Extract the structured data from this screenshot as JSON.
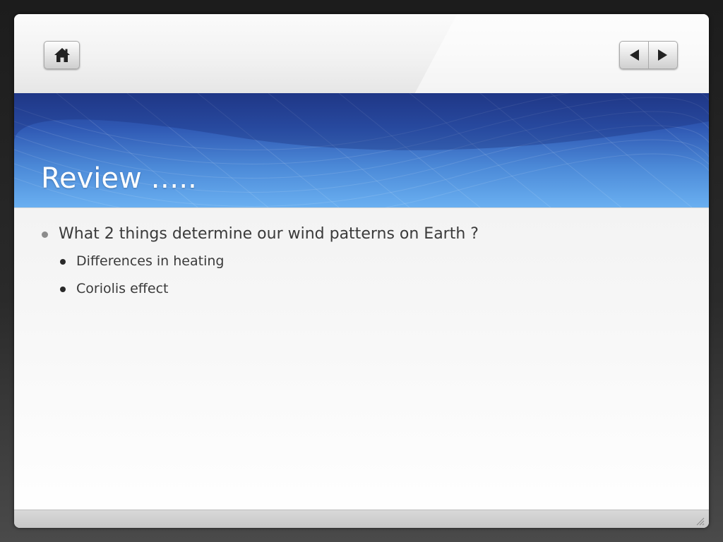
{
  "slide": {
    "title": "Review …..",
    "bullets": [
      {
        "text": "What 2 things determine our wind patterns on Earth ?",
        "sub": [
          "Differences in heating",
          "Coriolis effect"
        ]
      }
    ]
  },
  "nav": {
    "home_icon": "home-icon",
    "prev_icon": "triangle-left-icon",
    "next_icon": "triangle-right-icon"
  },
  "colors": {
    "title_band_top": "#233c8e",
    "title_band_bottom": "#6ab0f1",
    "title_text": "#ffffff",
    "body_text": "#3a3a3a"
  }
}
